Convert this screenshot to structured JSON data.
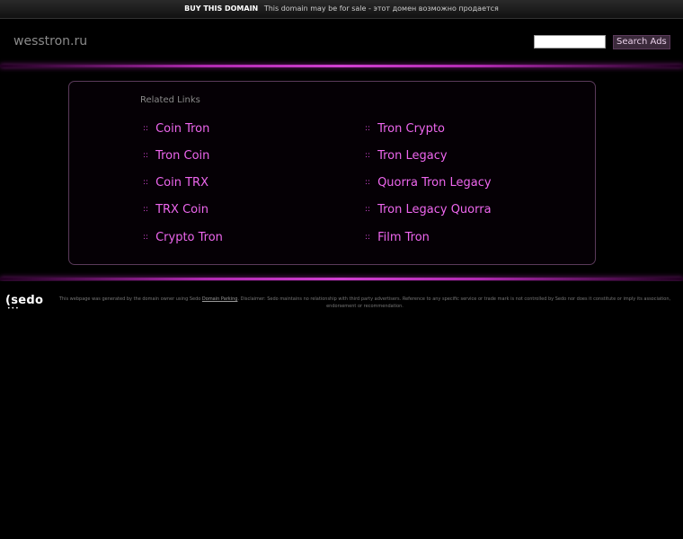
{
  "topbar": {
    "buy_label": "BUY THIS DOMAIN",
    "message": "This domain may be for sale - этот домен возможно продается"
  },
  "header": {
    "domain": "wesstron.ru",
    "search_placeholder": "",
    "search_button": "Search Ads"
  },
  "related": {
    "title": "Related Links",
    "left": [
      "Coin Tron",
      "Tron Coin",
      "Coin TRX",
      "TRX Coin",
      "Crypto Tron"
    ],
    "right": [
      "Tron Crypto",
      "Tron Legacy",
      "Quorra Tron Legacy",
      "Tron Legacy Quorra",
      "Film Tron"
    ],
    "bullet": "::"
  },
  "footer": {
    "logo": "sedo",
    "disclaimer_pre": "This webpage was generated by the domain owner using Sedo",
    "disclaimer_link": "Domain Parking",
    "disclaimer_post": ". Disclaimer: Sedo maintains no relationship with third party advertisers. Reference to any specific service or trade mark is not controlled by Sedo nor does it constitute or imply its association, endorsement or recommendation."
  }
}
